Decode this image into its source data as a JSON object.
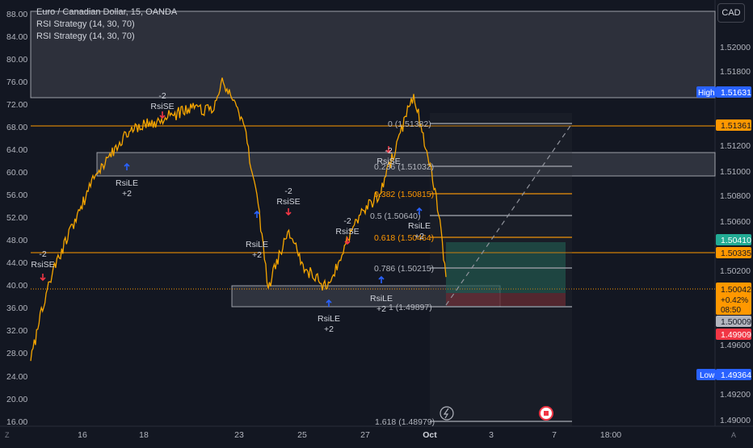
{
  "legend": {
    "symbol": "Euro / Canadian Dollar, 15, OANDA",
    "indicators": [
      "RSI Strategy (14, 30, 70)",
      "RSI Strategy (14, 30, 70)"
    ]
  },
  "currency_button": "CAD",
  "left_axis": {
    "ticks": [
      "88.00",
      "84.00",
      "80.00",
      "76.00",
      "72.00",
      "68.00",
      "64.00",
      "60.00",
      "56.00",
      "52.00",
      "48.00",
      "44.00",
      "40.00",
      "36.00",
      "32.00",
      "28.00",
      "24.00",
      "20.00",
      "16.00"
    ]
  },
  "right_axis": {
    "ticks": [
      "1.52000",
      "1.51800",
      "1.51200",
      "1.51000",
      "1.50800",
      "1.50600",
      "1.50200",
      "1.49600",
      "1.49200",
      "1.49000"
    ],
    "labels": {
      "high": {
        "tag": "High",
        "value": "1.51631"
      },
      "low": {
        "tag": "Low",
        "value": "1.49364"
      },
      "level_1": "1.51361",
      "level_2": "1.50410",
      "level_3": "1.50335",
      "last_price": "1.50042",
      "change": "+0.42%",
      "countdown": "08:50",
      "level_4": "1.50009",
      "level_5": "1.49909"
    }
  },
  "time_axis": {
    "ticks": [
      "16",
      "18",
      "23",
      "25",
      "27",
      "Oct",
      "3",
      "7",
      "18:00"
    ],
    "left_icon": "Z",
    "right_icon": "A"
  },
  "fibonacci": {
    "levels": [
      "0 (1.51382)",
      "0.236 (1.51032)",
      "0.382 (1.50815)",
      "0.5 (1.50640)",
      "0.618 (1.50464)",
      "0.786 (1.50215)",
      "1 (1.49897)",
      "1.618 (1.48979)"
    ]
  },
  "signals": {
    "rsise": "RsiSE",
    "rsile": "RsiLE",
    "minus2": "-2",
    "plus2": "+2"
  },
  "chart_data": {
    "type": "line",
    "title": "Euro / Canadian Dollar, 15, OANDA",
    "price_range": [
      1.4885,
      1.5225
    ],
    "x": [
      "16",
      "18",
      "23",
      "25",
      "27",
      "Oct"
    ],
    "series": [
      {
        "name": "EURCAD",
        "values": [
          1.4937,
          1.5,
          1.5085,
          1.512,
          1.513,
          1.514,
          1.5135,
          1.5163,
          1.513,
          1.507,
          1.4995,
          1.504,
          1.501,
          1.4995,
          1.505,
          1.507,
          1.515,
          1.507,
          1.5004
        ]
      }
    ],
    "rsi_axis_range": [
      16,
      88
    ],
    "colors": {
      "candle": "#f7a600",
      "line_orange": "#ff9800",
      "line_gray": "#b2b5be",
      "zone_green": "#1f6f5d",
      "zone_red": "#7c2a32",
      "high_label": "#2962ff",
      "low_label": "#2962ff",
      "level_green": "#22ab94",
      "level_red": "#f23645"
    }
  }
}
